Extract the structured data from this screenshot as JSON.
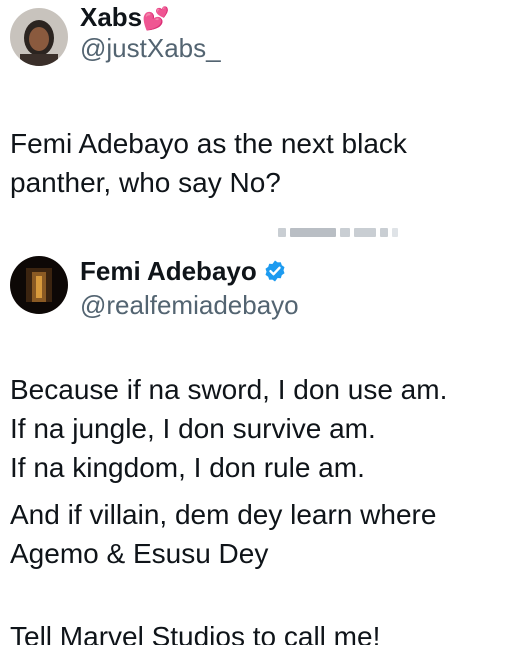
{
  "tweet1": {
    "author_name": "Xabs",
    "author_emoji": "💕",
    "handle": "@justXabs_",
    "text_lines": [
      "Femi Adebayo as the next black",
      "panther, who say No?"
    ]
  },
  "tweet2": {
    "author_name": "Femi Adebayo",
    "verified": true,
    "handle": "@realfemiadebayo",
    "text_lines": [
      "Because if na sword, I don use am.",
      "If na jungle, I don survive am.",
      "If na kingdom, I don rule am.",
      "And if villain, dem dey learn where",
      "Agemo & Esusu Dey"
    ],
    "closing_line": "Tell Marvel Studios to call me!"
  },
  "colors": {
    "text": "#0f1419",
    "handle": "#536471",
    "verified_badge": "#1d9bf0",
    "heart_emoji": "#f06ab2"
  },
  "icons": {
    "verified": "verified-badge-icon",
    "emoji": "two-hearts-emoji"
  }
}
